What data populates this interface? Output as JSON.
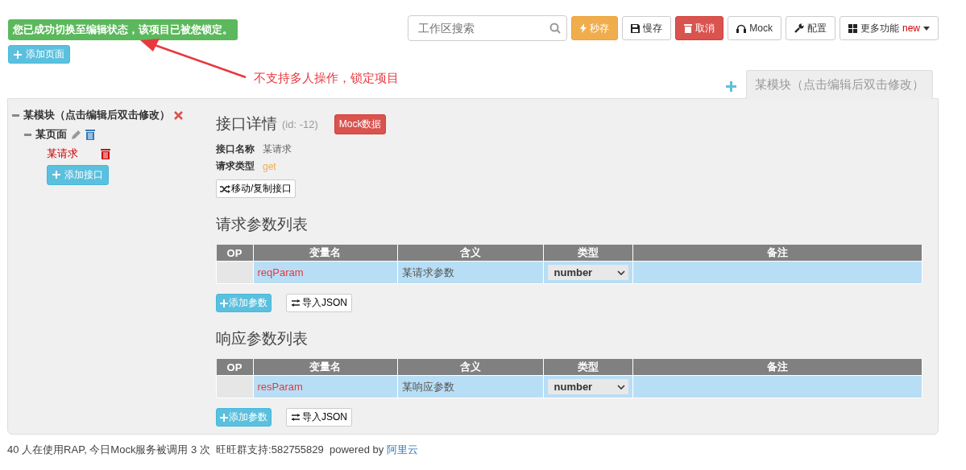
{
  "alert": {
    "text": "您已成功切换至编辑状态，该项目已被您锁定。"
  },
  "add_page_button": {
    "label": "添加页面"
  },
  "annotation": {
    "text": "不支持多人操作，锁定项目"
  },
  "search": {
    "placeholder": "工作区搜索"
  },
  "toolbar": [
    {
      "kind": "quick-save",
      "label": "秒存"
    },
    {
      "kind": "save",
      "label": "慢存"
    },
    {
      "kind": "cancel",
      "label": "取消"
    },
    {
      "kind": "mock",
      "label": "Mock"
    },
    {
      "kind": "config",
      "label": "配置"
    },
    {
      "kind": "more",
      "label": "更多功能",
      "badge": "new"
    }
  ],
  "module_tabs": [
    {
      "label": "某模块（点击编辑后双击修改）",
      "selected": true
    }
  ],
  "tree": {
    "module": "某模块（点击编辑后双击修改）",
    "page": "某页面",
    "requests": [
      {
        "label": "某请求",
        "selected": true
      }
    ],
    "add_button": "添加接口"
  },
  "detail": {
    "title": "接口详情",
    "id": "(id: -12)",
    "mock_button": "Mock数据",
    "fields": [
      {
        "label": "接口名称",
        "value": "某请求",
        "kind": "text"
      },
      {
        "label": "请求类型",
        "value": "get",
        "kind": "method"
      }
    ],
    "move_button": "移动/复制接口"
  },
  "param_tables": [
    {
      "title": "请求参数列表",
      "columns": [
        "OP",
        "变量名",
        "含义",
        "类型",
        "备注"
      ],
      "rows": [
        {
          "name": "reqParam",
          "meaning": "某请求参数",
          "type": "number"
        }
      ],
      "add_button": "添加参数",
      "import_button": "导入JSON"
    },
    {
      "title": "响应参数列表",
      "columns": [
        "OP",
        "变量名",
        "含义",
        "类型",
        "备注"
      ],
      "rows": [
        {
          "name": "resParam",
          "meaning": "某响应参数",
          "type": "number"
        }
      ],
      "add_button": "添加参数",
      "import_button": "导入JSON"
    }
  ],
  "footer": {
    "text": "40 人在使用RAP, 今日Mock服务被调用 3 次  旺旺群支持:582755829  powered by",
    "link": "阿里云"
  }
}
